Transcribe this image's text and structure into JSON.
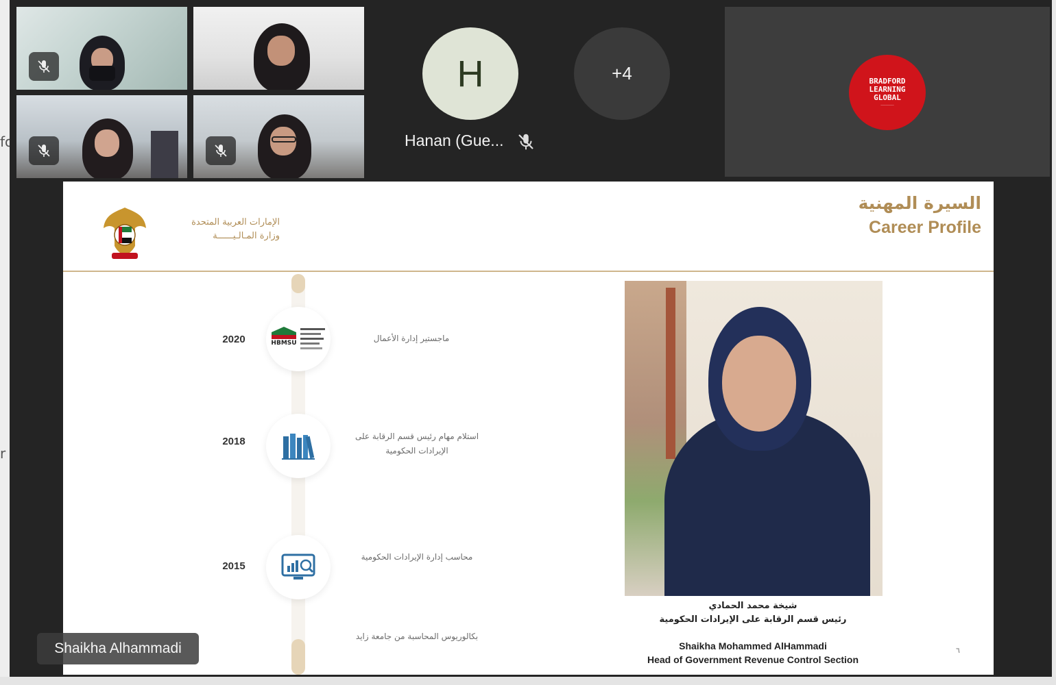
{
  "participants": {
    "hanan": {
      "initial": "H",
      "name": "Hanan (Gue..."
    },
    "overflow_count": "+4",
    "bradford_logo_text": [
      "BRADFORD",
      "LEARNING",
      "GLOBAL"
    ]
  },
  "speaker_name": "Shaikha Alhammadi",
  "slide": {
    "ministry_line1": "الإمارات العربية المتحدة",
    "ministry_line2": "وزارة المـالـيــــــة",
    "title_ar": "السيرة المهنية",
    "title_en": "Career Profile",
    "timeline": [
      {
        "year": "2020",
        "text": "ماجستير إدارة الأعمال",
        "icon": "university-logo-icon"
      },
      {
        "year": "2018",
        "text": "استلام مهام رئيس قسم الرقابة على الإيرادات الحكومية",
        "icon": "books-icon"
      },
      {
        "year": "2015",
        "text": "محاسب إدارة الإيرادات الحكومية",
        "icon": "monitor-chart-icon"
      },
      {
        "year": "",
        "text": "بكالوريوس المحاسبة من جامعة زايد",
        "icon": ""
      }
    ],
    "caption_ar_name": "شيخة محمد الحمادي",
    "caption_ar_role": "رئيس قسم الرقابة على الإيرادات الحكومية",
    "caption_en_name": "Shaikha Mohammed AlHammadi",
    "caption_en_role": "Head of Government Revenue Control Section",
    "page_number": "٦"
  },
  "colors": {
    "accent_gold": "#b08d56",
    "meeting_bg": "#242424",
    "active_speaker_border": "#7b83eb",
    "bradford_red": "#d0141b",
    "timeline_icon_blue": "#2e6fa3"
  }
}
